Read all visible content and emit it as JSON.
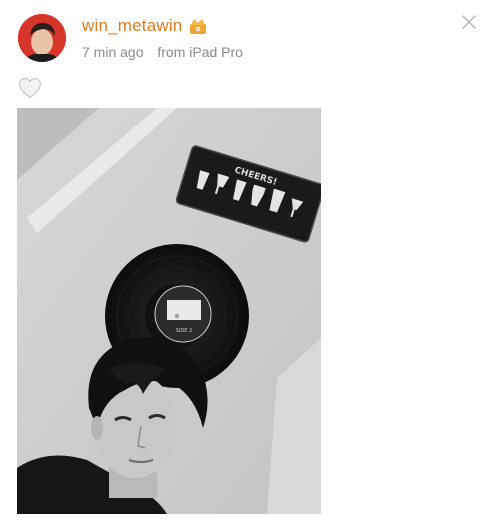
{
  "post": {
    "username": "win_metawin",
    "time": "7 min ago",
    "source": "from iPad Pro",
    "badge_icon": "crown-badge-icon",
    "like_icon": "heart-icon",
    "close_icon": "close-icon",
    "photo": {
      "plate_text": "CHEERS!",
      "record_label_text": "SIDE 2"
    }
  },
  "colors": {
    "accent": "#e07b1f",
    "meta": "#8b8b8b",
    "avatar_bg": "#d8352a"
  }
}
